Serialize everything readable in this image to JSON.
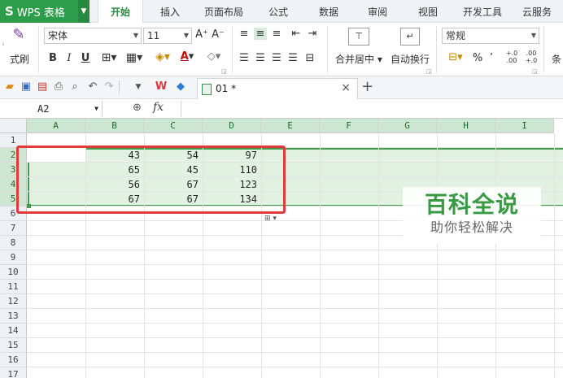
{
  "menubar": {
    "app_logo": "S",
    "app_name": "WPS 表格",
    "items": [
      "开始",
      "插入",
      "页面布局",
      "公式",
      "数据",
      "审阅",
      "视图",
      "开发工具",
      "云服务"
    ],
    "active": "开始"
  },
  "ribbon": {
    "format_painter_label": "式刷",
    "font_name": "宋体",
    "font_size": "11",
    "grow_font": "A⁺",
    "shrink_font": "A⁻",
    "bold": "B",
    "italic": "I",
    "underline": "U",
    "font_color_letter": "A",
    "merge_center_label": "合并居中",
    "wrap_text_label": "自动换行",
    "number_format": "常规",
    "percent": "%",
    "comma": "’",
    "inc_decimal": "+.0\n.00",
    "dec_decimal": ".00\n+.0",
    "conditional_label": "条"
  },
  "qat": {
    "doc_tab_name": "01 *",
    "close_glyph": "×",
    "new_tab_glyph": "+"
  },
  "formula_bar": {
    "name_box": "A2",
    "fx_label": "fx",
    "formula": ""
  },
  "grid": {
    "columns": [
      "A",
      "B",
      "C",
      "D",
      "E",
      "F",
      "G",
      "H",
      "I"
    ],
    "rows": [
      "1",
      "2",
      "3",
      "4",
      "5",
      "6",
      "7",
      "8",
      "9",
      "10",
      "11",
      "12",
      "13",
      "14",
      "15",
      "16",
      "17"
    ],
    "data": [
      {
        "row": "2",
        "B": "43",
        "C": "54",
        "D": "97"
      },
      {
        "row": "3",
        "B": "65",
        "C": "45",
        "D": "110"
      },
      {
        "row": "4",
        "B": "56",
        "C": "67",
        "D": "123"
      },
      {
        "row": "5",
        "B": "67",
        "C": "67",
        "D": "134"
      }
    ],
    "selected_rows": [
      "2",
      "3",
      "4",
      "5"
    ],
    "selected_columns": [
      "A",
      "B",
      "C",
      "D",
      "E",
      "F",
      "G",
      "H",
      "I"
    ]
  },
  "watermark": {
    "title": "百科全说",
    "subtitle": "助你轻松解决"
  },
  "colors": {
    "accent_green": "#2e9d49",
    "selection_fill": "#cde6d2",
    "highlight_red": "#e23a3a"
  }
}
